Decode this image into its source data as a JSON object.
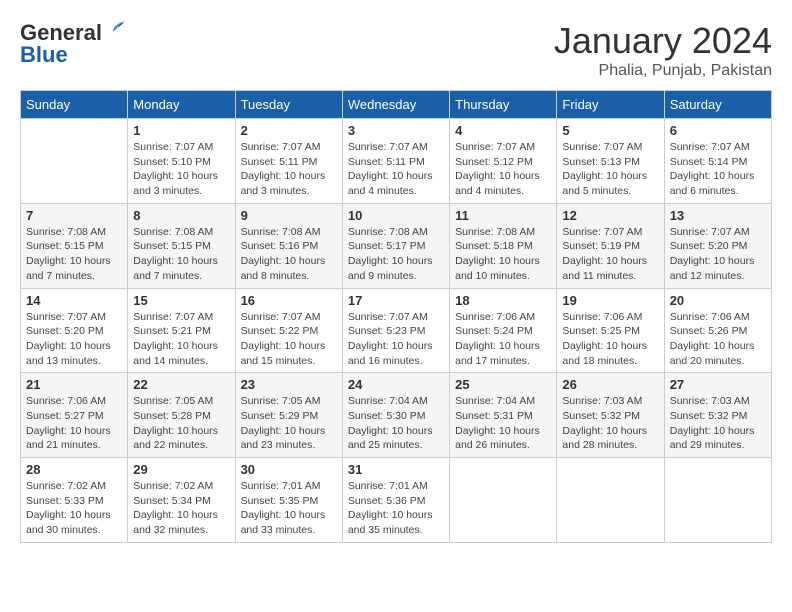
{
  "header": {
    "logo_general": "General",
    "logo_blue": "Blue",
    "month_year": "January 2024",
    "location": "Phalia, Punjab, Pakistan"
  },
  "columns": [
    "Sunday",
    "Monday",
    "Tuesday",
    "Wednesday",
    "Thursday",
    "Friday",
    "Saturday"
  ],
  "weeks": [
    [
      {
        "day": "",
        "sunrise": "",
        "sunset": "",
        "daylight": ""
      },
      {
        "day": "1",
        "sunrise": "Sunrise: 7:07 AM",
        "sunset": "Sunset: 5:10 PM",
        "daylight": "Daylight: 10 hours and 3 minutes."
      },
      {
        "day": "2",
        "sunrise": "Sunrise: 7:07 AM",
        "sunset": "Sunset: 5:11 PM",
        "daylight": "Daylight: 10 hours and 3 minutes."
      },
      {
        "day": "3",
        "sunrise": "Sunrise: 7:07 AM",
        "sunset": "Sunset: 5:11 PM",
        "daylight": "Daylight: 10 hours and 4 minutes."
      },
      {
        "day": "4",
        "sunrise": "Sunrise: 7:07 AM",
        "sunset": "Sunset: 5:12 PM",
        "daylight": "Daylight: 10 hours and 4 minutes."
      },
      {
        "day": "5",
        "sunrise": "Sunrise: 7:07 AM",
        "sunset": "Sunset: 5:13 PM",
        "daylight": "Daylight: 10 hours and 5 minutes."
      },
      {
        "day": "6",
        "sunrise": "Sunrise: 7:07 AM",
        "sunset": "Sunset: 5:14 PM",
        "daylight": "Daylight: 10 hours and 6 minutes."
      }
    ],
    [
      {
        "day": "7",
        "sunrise": "Sunrise: 7:08 AM",
        "sunset": "Sunset: 5:15 PM",
        "daylight": "Daylight: 10 hours and 7 minutes."
      },
      {
        "day": "8",
        "sunrise": "Sunrise: 7:08 AM",
        "sunset": "Sunset: 5:15 PM",
        "daylight": "Daylight: 10 hours and 7 minutes."
      },
      {
        "day": "9",
        "sunrise": "Sunrise: 7:08 AM",
        "sunset": "Sunset: 5:16 PM",
        "daylight": "Daylight: 10 hours and 8 minutes."
      },
      {
        "day": "10",
        "sunrise": "Sunrise: 7:08 AM",
        "sunset": "Sunset: 5:17 PM",
        "daylight": "Daylight: 10 hours and 9 minutes."
      },
      {
        "day": "11",
        "sunrise": "Sunrise: 7:08 AM",
        "sunset": "Sunset: 5:18 PM",
        "daylight": "Daylight: 10 hours and 10 minutes."
      },
      {
        "day": "12",
        "sunrise": "Sunrise: 7:07 AM",
        "sunset": "Sunset: 5:19 PM",
        "daylight": "Daylight: 10 hours and 11 minutes."
      },
      {
        "day": "13",
        "sunrise": "Sunrise: 7:07 AM",
        "sunset": "Sunset: 5:20 PM",
        "daylight": "Daylight: 10 hours and 12 minutes."
      }
    ],
    [
      {
        "day": "14",
        "sunrise": "Sunrise: 7:07 AM",
        "sunset": "Sunset: 5:20 PM",
        "daylight": "Daylight: 10 hours and 13 minutes."
      },
      {
        "day": "15",
        "sunrise": "Sunrise: 7:07 AM",
        "sunset": "Sunset: 5:21 PM",
        "daylight": "Daylight: 10 hours and 14 minutes."
      },
      {
        "day": "16",
        "sunrise": "Sunrise: 7:07 AM",
        "sunset": "Sunset: 5:22 PM",
        "daylight": "Daylight: 10 hours and 15 minutes."
      },
      {
        "day": "17",
        "sunrise": "Sunrise: 7:07 AM",
        "sunset": "Sunset: 5:23 PM",
        "daylight": "Daylight: 10 hours and 16 minutes."
      },
      {
        "day": "18",
        "sunrise": "Sunrise: 7:06 AM",
        "sunset": "Sunset: 5:24 PM",
        "daylight": "Daylight: 10 hours and 17 minutes."
      },
      {
        "day": "19",
        "sunrise": "Sunrise: 7:06 AM",
        "sunset": "Sunset: 5:25 PM",
        "daylight": "Daylight: 10 hours and 18 minutes."
      },
      {
        "day": "20",
        "sunrise": "Sunrise: 7:06 AM",
        "sunset": "Sunset: 5:26 PM",
        "daylight": "Daylight: 10 hours and 20 minutes."
      }
    ],
    [
      {
        "day": "21",
        "sunrise": "Sunrise: 7:06 AM",
        "sunset": "Sunset: 5:27 PM",
        "daylight": "Daylight: 10 hours and 21 minutes."
      },
      {
        "day": "22",
        "sunrise": "Sunrise: 7:05 AM",
        "sunset": "Sunset: 5:28 PM",
        "daylight": "Daylight: 10 hours and 22 minutes."
      },
      {
        "day": "23",
        "sunrise": "Sunrise: 7:05 AM",
        "sunset": "Sunset: 5:29 PM",
        "daylight": "Daylight: 10 hours and 23 minutes."
      },
      {
        "day": "24",
        "sunrise": "Sunrise: 7:04 AM",
        "sunset": "Sunset: 5:30 PM",
        "daylight": "Daylight: 10 hours and 25 minutes."
      },
      {
        "day": "25",
        "sunrise": "Sunrise: 7:04 AM",
        "sunset": "Sunset: 5:31 PM",
        "daylight": "Daylight: 10 hours and 26 minutes."
      },
      {
        "day": "26",
        "sunrise": "Sunrise: 7:03 AM",
        "sunset": "Sunset: 5:32 PM",
        "daylight": "Daylight: 10 hours and 28 minutes."
      },
      {
        "day": "27",
        "sunrise": "Sunrise: 7:03 AM",
        "sunset": "Sunset: 5:32 PM",
        "daylight": "Daylight: 10 hours and 29 minutes."
      }
    ],
    [
      {
        "day": "28",
        "sunrise": "Sunrise: 7:02 AM",
        "sunset": "Sunset: 5:33 PM",
        "daylight": "Daylight: 10 hours and 30 minutes."
      },
      {
        "day": "29",
        "sunrise": "Sunrise: 7:02 AM",
        "sunset": "Sunset: 5:34 PM",
        "daylight": "Daylight: 10 hours and 32 minutes."
      },
      {
        "day": "30",
        "sunrise": "Sunrise: 7:01 AM",
        "sunset": "Sunset: 5:35 PM",
        "daylight": "Daylight: 10 hours and 33 minutes."
      },
      {
        "day": "31",
        "sunrise": "Sunrise: 7:01 AM",
        "sunset": "Sunset: 5:36 PM",
        "daylight": "Daylight: 10 hours and 35 minutes."
      },
      {
        "day": "",
        "sunrise": "",
        "sunset": "",
        "daylight": ""
      },
      {
        "day": "",
        "sunrise": "",
        "sunset": "",
        "daylight": ""
      },
      {
        "day": "",
        "sunrise": "",
        "sunset": "",
        "daylight": ""
      }
    ]
  ]
}
